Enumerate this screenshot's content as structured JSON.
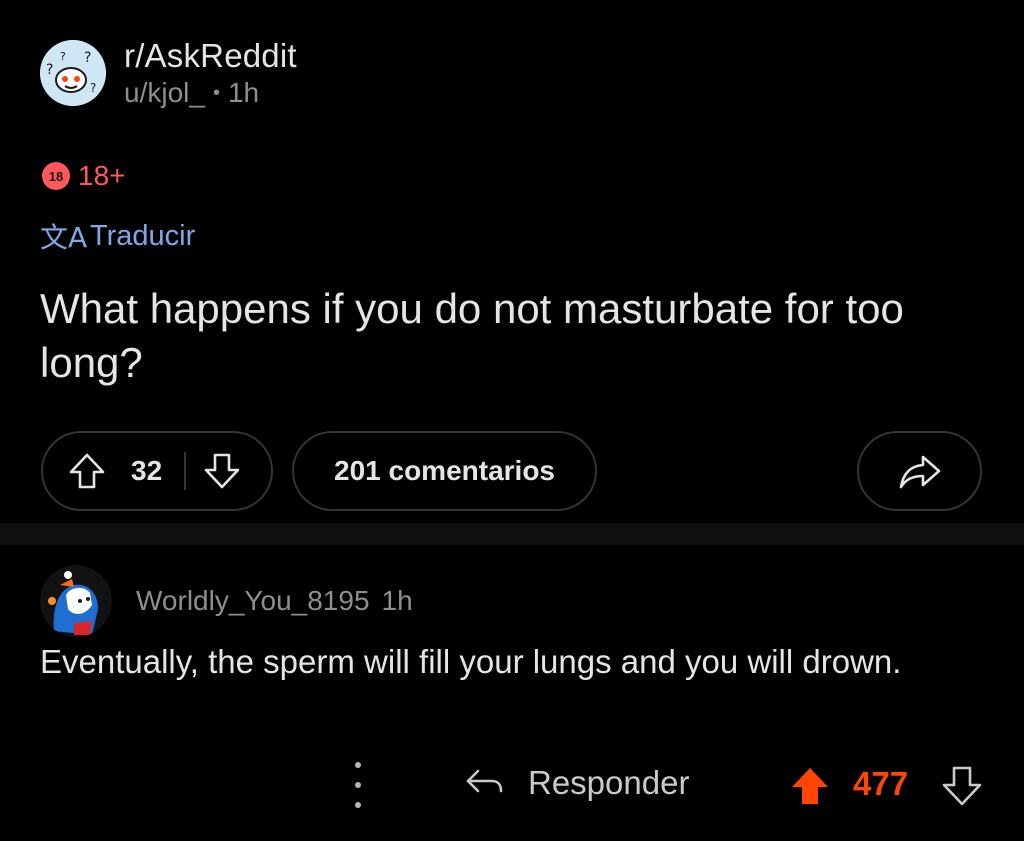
{
  "post": {
    "subreddit": "r/AskReddit",
    "author": "u/kjol_",
    "separator": "•",
    "age": "1h",
    "nsfw_badge_text": "18",
    "nsfw_label": "18+",
    "translate_icon": "文A",
    "translate_label": "Traducir",
    "title": "What happens if you do not masturbate for too long?",
    "score": "32",
    "comments_label": "201 comentarios"
  },
  "comment": {
    "author": "Worldly_You_8195",
    "age": "1h",
    "body": "Eventually, the sperm will fill your lungs and you will drown.",
    "reply_label": "Responder",
    "score": "477"
  },
  "icons": {
    "subreddit_avatar": "askreddit-snoo-icon",
    "upvote": "arrow-up-icon",
    "downvote": "arrow-down-icon",
    "share": "share-arrow-icon",
    "more": "more-vertical-icon",
    "reply": "reply-arrow-icon",
    "comment_upvote_active": "arrow-up-filled-icon",
    "user_avatar": "user-avatar-icon"
  },
  "colors": {
    "background": "#000000",
    "text_primary": "#e3e5e7",
    "text_secondary": "#8b8f93",
    "nsfw": "#ff585b",
    "link": "#7fa8e8",
    "upvote_active": "#ff4500",
    "border": "#343536"
  }
}
